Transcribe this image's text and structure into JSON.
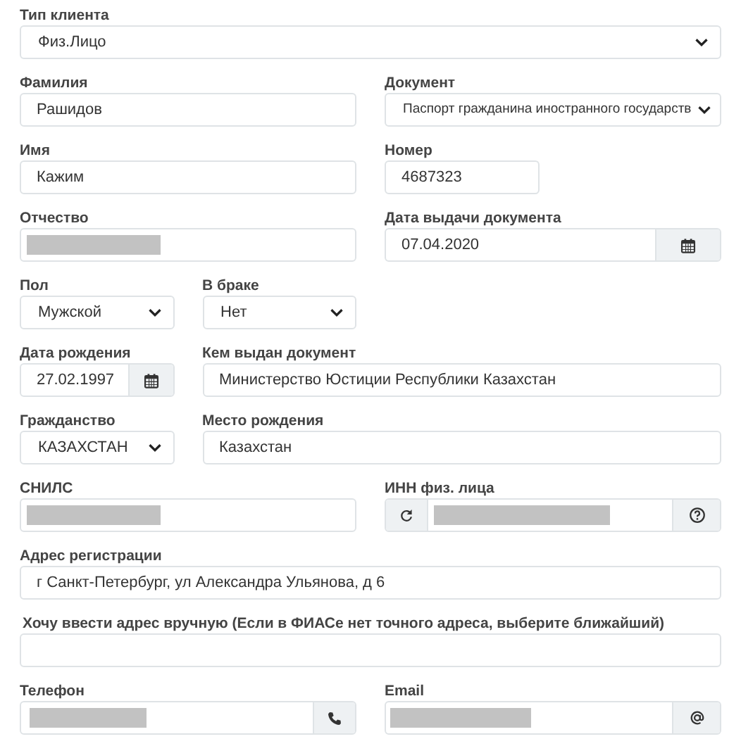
{
  "fields": [
    {
      "label": "Тип клиента",
      "kind": "select",
      "value": "Физ.Лицо"
    },
    {
      "label": "Фамилия",
      "kind": "input",
      "value": "Рашидов"
    },
    {
      "label": "Документ",
      "kind": "select",
      "value": "Паспорт гражданина иностранного государств"
    },
    {
      "label": "Имя",
      "kind": "input",
      "value": "Кажим"
    },
    {
      "label": "Номер",
      "kind": "input",
      "value": "4687323"
    },
    {
      "label": "Отчество",
      "kind": "input",
      "redacted": true
    },
    {
      "label": "Дата выдачи документа",
      "kind": "date",
      "value": "07.04.2020"
    },
    {
      "label": "Пол",
      "kind": "select",
      "value": "Мужской"
    },
    {
      "label": "В браке",
      "kind": "select",
      "value": "Нет"
    },
    {
      "label": "Дата рождения",
      "kind": "date",
      "value": "27.02.1997"
    },
    {
      "label": "Кем выдан документ",
      "kind": "input",
      "value": "Министерство Юстиции Республики Казахстан"
    },
    {
      "label": "Гражданство",
      "kind": "select",
      "value": "КАЗАХСТАН"
    },
    {
      "label": "Место рождения",
      "kind": "input",
      "value": "Казахстан"
    },
    {
      "label": "СНИЛС",
      "kind": "input",
      "redacted": true
    },
    {
      "label": "ИНН физ. лица",
      "kind": "inn",
      "redacted": true
    },
    {
      "label": "Адрес регистрации",
      "kind": "input",
      "value": "г Санкт-Петербург, ул Александра Ульянова, д 6"
    },
    {
      "label": "Хочу ввести адрес вручную (Если в ФИАСе нет точного адреса, выберите ближайший)",
      "kind": "input"
    },
    {
      "label": "Телефон",
      "kind": "phone",
      "redacted": true
    },
    {
      "label": "Email",
      "kind": "email",
      "redacted": true
    }
  ]
}
